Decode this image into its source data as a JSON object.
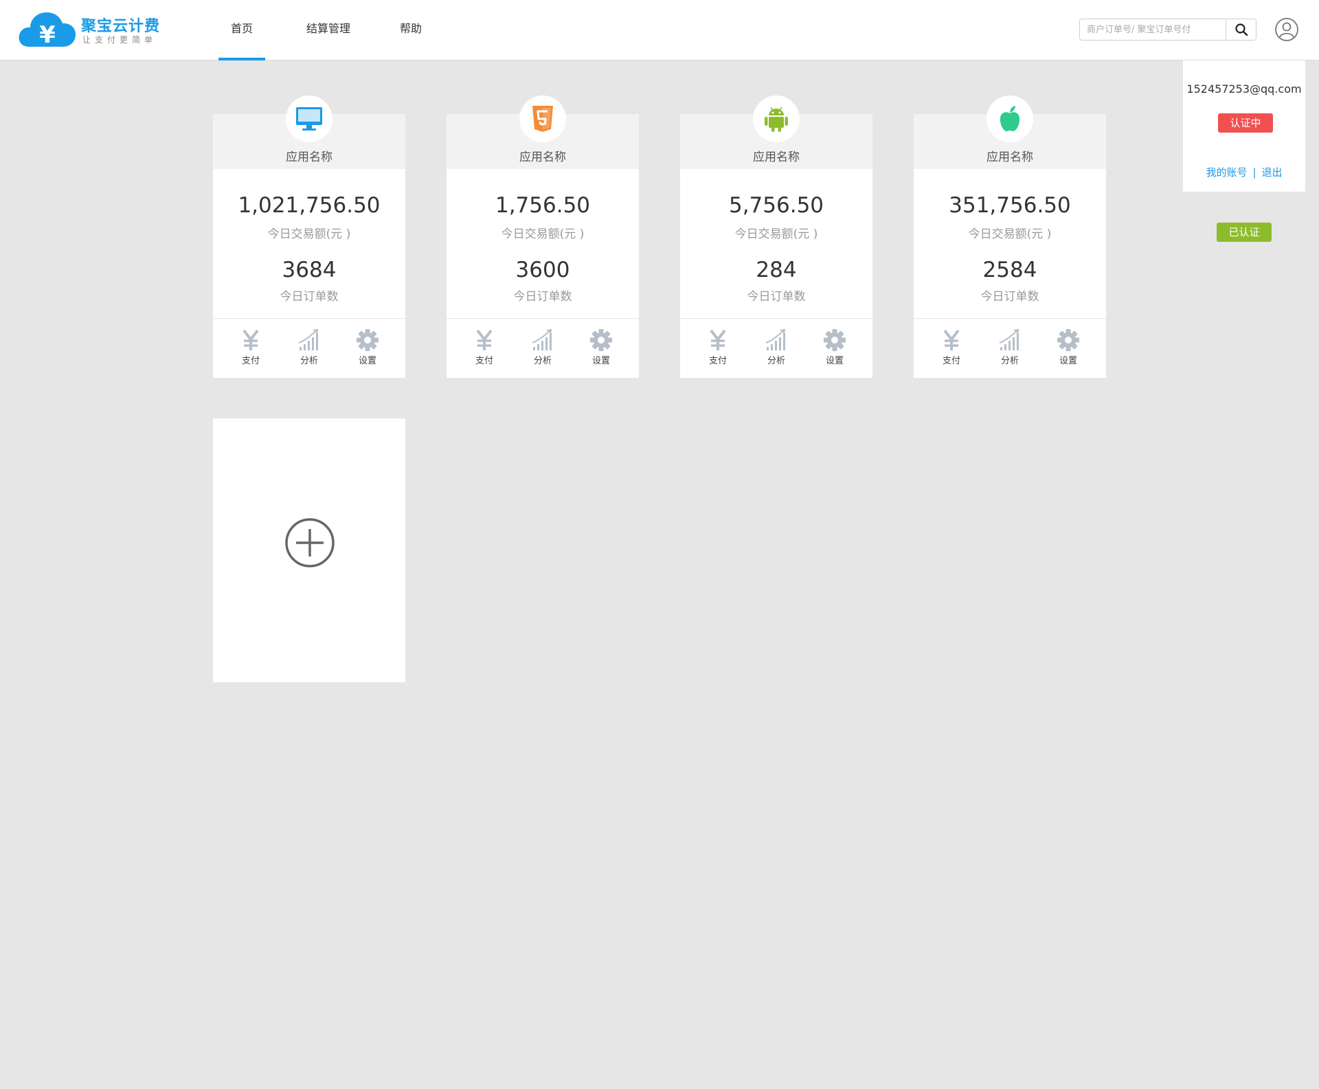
{
  "logo": {
    "name": "聚宝云计费",
    "slogan": "让支付更简单",
    "icon": "cloud-yen-icon",
    "brand_color": "#1a9be8"
  },
  "nav": {
    "items": [
      {
        "label": "首页",
        "active": true
      },
      {
        "label": "结算管理",
        "active": false
      },
      {
        "label": "帮助",
        "active": false
      }
    ]
  },
  "search": {
    "placeholder": "商户订单号/ 聚宝订单号付",
    "value": "",
    "icon": "search-icon"
  },
  "user": {
    "avatar_icon": "user-icon",
    "email": "152457253@qq.com",
    "status_pending": "认证中",
    "my_account": "我的账号",
    "separator": "|",
    "logout": "退出",
    "status_verified": "已认证",
    "colors": {
      "pending": "#f0504f",
      "verified": "#8cbc2c"
    }
  },
  "cards": [
    {
      "icon": "desktop-icon",
      "icon_color": "#1a9be8",
      "name": "应用名称",
      "amount": "1,021,756.50",
      "amount_label": "今日交易额(元 )",
      "orders": "3684",
      "orders_label": "今日订单数"
    },
    {
      "icon": "html5-icon",
      "icon_color": "#f28c3a",
      "name": "应用名称",
      "amount": "1,756.50",
      "amount_label": "今日交易额(元 )",
      "orders": "3600",
      "orders_label": "今日订单数"
    },
    {
      "icon": "android-icon",
      "icon_color": "#8cbc2c",
      "name": "应用名称",
      "amount": "5,756.50",
      "amount_label": "今日交易额(元 )",
      "orders": "284",
      "orders_label": "今日订单数"
    },
    {
      "icon": "apple-icon",
      "icon_color": "#2ecb8a",
      "name": "应用名称",
      "amount": "351,756.50",
      "amount_label": "今日交易额(元 )",
      "orders": "2584",
      "orders_label": "今日订单数"
    }
  ],
  "card_actions": [
    {
      "label": "支付",
      "icon": "yen-icon"
    },
    {
      "label": "分析",
      "icon": "bar-chart-icon"
    },
    {
      "label": "设置",
      "icon": "gear-icon"
    }
  ],
  "add_card": {
    "icon": "plus-circle-icon"
  }
}
